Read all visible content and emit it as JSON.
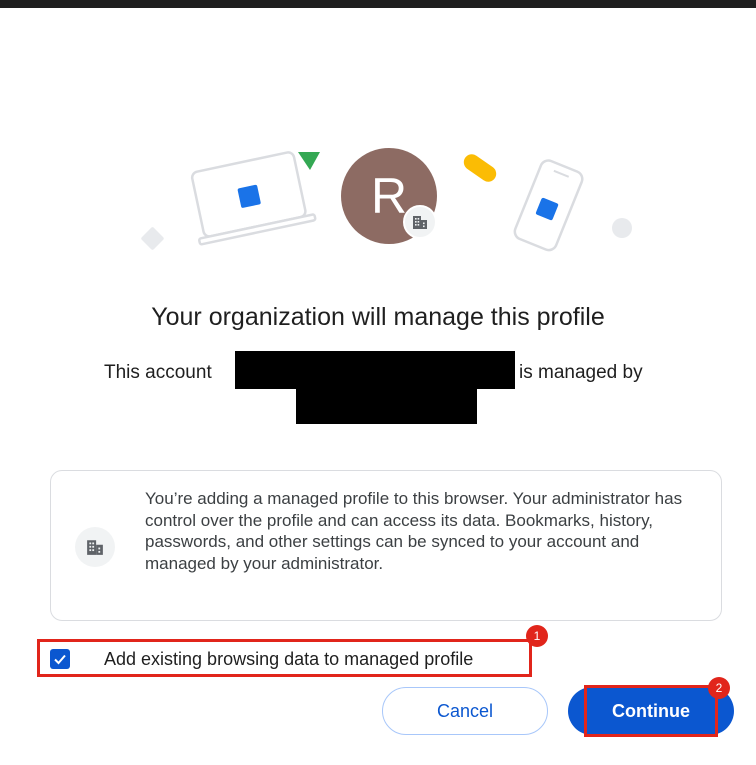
{
  "avatar": {
    "initial": "R"
  },
  "dialog": {
    "title": "Your organization will manage this profile",
    "account_prefix": "This account",
    "account_suffix": "is managed by"
  },
  "info_card": {
    "text": "You’re adding a managed profile to this browser. Your administrator has control over the profile and can access its data. Bookmarks, history, passwords, and other settings can be synced to your account and managed by your administrator."
  },
  "checkbox": {
    "label": "Add existing browsing data to managed profile",
    "checked": true
  },
  "buttons": {
    "cancel": "Cancel",
    "continue": "Continue"
  },
  "annotations": {
    "step_1": "1",
    "step_2": "2"
  },
  "icons": {
    "avatar_badge": "building-icon",
    "info": "building-icon",
    "checkbox": "checkmark-icon"
  },
  "colors": {
    "primary_blue": "#0b57d0",
    "avatar_bg": "#8d6b63",
    "annotation_red": "#e1251b",
    "illustration_green": "#34a853",
    "illustration_yellow": "#fbbc04"
  }
}
